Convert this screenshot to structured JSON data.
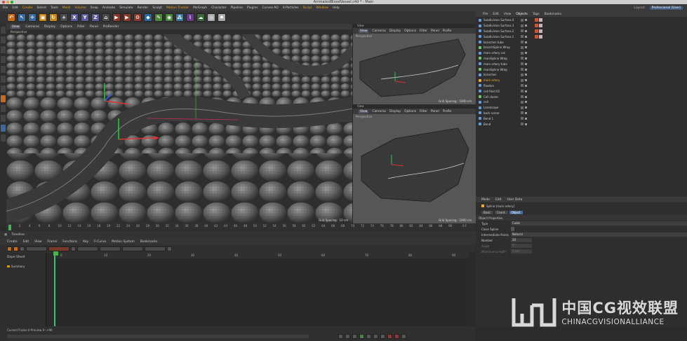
{
  "window": {
    "title": "AnimatedBloodVessel.c4d * - Main"
  },
  "menu": [
    "File",
    "Edit",
    "Create",
    "Select",
    "Tools",
    "Mesh",
    "Volume",
    "Snap",
    "Animate",
    "Simulate",
    "Render",
    "Sculpt",
    "Motion Tracker",
    "MoGraph",
    "Character",
    "Pipeline",
    "Plugins",
    "Curves AO",
    "X-Particles",
    "Script",
    "Window",
    "Help"
  ],
  "menu_right": {
    "layout_label": "Layout:",
    "layout_value": "Professional (User)"
  },
  "toolbar_letters": [
    "X",
    "Y",
    "Z"
  ],
  "viewport_main": {
    "menu": [
      "View",
      "Cameras",
      "Display",
      "Options",
      "Filter",
      "Panel",
      "ProRender"
    ],
    "name": "Perspective",
    "grid": "Grid Spacing : 10 cm"
  },
  "viewport_tr": {
    "label": "View",
    "menu": [
      "View",
      "Cameras",
      "Display",
      "Options",
      "Filter",
      "Panel",
      "ProRe"
    ],
    "name": "Perspective",
    "grid": "Grid Spacing : 1000 cm"
  },
  "viewport_br": {
    "label": "View",
    "menu": [
      "View",
      "Cameras",
      "Display",
      "Options",
      "Filter",
      "Panel",
      "ProRe"
    ],
    "name": "Perspective",
    "grid": "Grid Spacing : 1000 cm"
  },
  "timeline_ticks": [
    "0",
    "2",
    "4",
    "6",
    "8",
    "10",
    "12",
    "14",
    "16",
    "18",
    "20",
    "22",
    "24",
    "26",
    "28",
    "30",
    "32",
    "34",
    "36",
    "38",
    "40",
    "42",
    "44",
    "46",
    "48",
    "50",
    "52",
    "54",
    "56",
    "58",
    "60",
    "62",
    "64",
    "66",
    "68",
    "70",
    "72",
    "74",
    "76",
    "78",
    "80",
    "82",
    "84",
    "86",
    "88",
    "90"
  ],
  "timeline_end": "0 F",
  "timeline_panel": {
    "title": "Timeline",
    "menu": [
      "Create",
      "Edit",
      "View",
      "Frame",
      "Functions",
      "Key",
      "F-Curve",
      "Motion System",
      "Bookmarks"
    ],
    "dope_label": "Dope Sheet",
    "summary_label": "Summary",
    "frame_labels": [
      "0",
      "10",
      "20",
      "30",
      "40",
      "50",
      "60",
      "70",
      "80",
      "90"
    ],
    "status": "Current Frame  0  Preview  0-->90"
  },
  "objects_panel": {
    "menu": [
      "File",
      "Edit",
      "View",
      "Objects",
      "Tags",
      "Bookmarks"
    ],
    "items": [
      {
        "label": "Subdivision Surface.4",
        "icon": "blue",
        "tags": true
      },
      {
        "label": "Subdivision Surface.3",
        "icon": "blue",
        "tags": true
      },
      {
        "label": "Subdivision Surface.2",
        "icon": "blue",
        "tags": true
      },
      {
        "label": "Subdivision Surface.1",
        "icon": "blue",
        "tags": true
      },
      {
        "label": "branches tube",
        "icon": "blue",
        "tags": false
      },
      {
        "label": "branchSpline Wrap",
        "icon": "green",
        "tags": false
      },
      {
        "label": "main artery cut",
        "icon": "blue",
        "tags": false
      },
      {
        "label": "mainSpline Wrap",
        "icon": "green",
        "tags": false
      },
      {
        "label": "main artery tube",
        "icon": "blue",
        "tags": false
      },
      {
        "label": "mainSpline Wrap",
        "icon": "green",
        "tags": false
      },
      {
        "label": "branches",
        "icon": "blue",
        "tags": false
      },
      {
        "label": "main artery",
        "icon": "yellow",
        "tags": false
      },
      {
        "label": "floodun",
        "icon": "blue",
        "tags": false
      },
      {
        "label": "cell field 02",
        "icon": "blue",
        "tags": false
      },
      {
        "label": "Cell cloner",
        "icon": "green",
        "tags": false
      },
      {
        "label": "cell",
        "icon": "blue",
        "tags": false
      },
      {
        "label": "Landscape",
        "icon": "blue",
        "tags": false
      },
      {
        "label": "back scene",
        "icon": "blue",
        "tags": false
      },
      {
        "label": "Bend 1",
        "icon": "blue",
        "tags": false
      },
      {
        "label": "Bend",
        "icon": "blue",
        "tags": false
      }
    ]
  },
  "attributes_panel": {
    "menu": [
      "Mode",
      "Edit",
      "User Data"
    ],
    "object_label": "Spline [main artery]",
    "tabs": [
      "Basic",
      "Coord.",
      "Object"
    ],
    "section": "Object Properties",
    "props": [
      {
        "label": "Type",
        "value": "Cubic"
      },
      {
        "label": "Close Spline",
        "value": ""
      },
      {
        "label": "Intermediate Points",
        "value": "Natural"
      },
      {
        "label": "Number",
        "value": "20"
      },
      {
        "label": "Angle",
        "value": "5°"
      },
      {
        "label": "Maximum Length",
        "value": "5 cm"
      }
    ]
  },
  "watermark": {
    "line1": "中国CG视效联盟",
    "line2": "CHINACGVISIONALLIANCE"
  },
  "colors": {
    "accent": "#f0a020",
    "selection": "#4a6a9a",
    "playhead": "#3ac060"
  }
}
